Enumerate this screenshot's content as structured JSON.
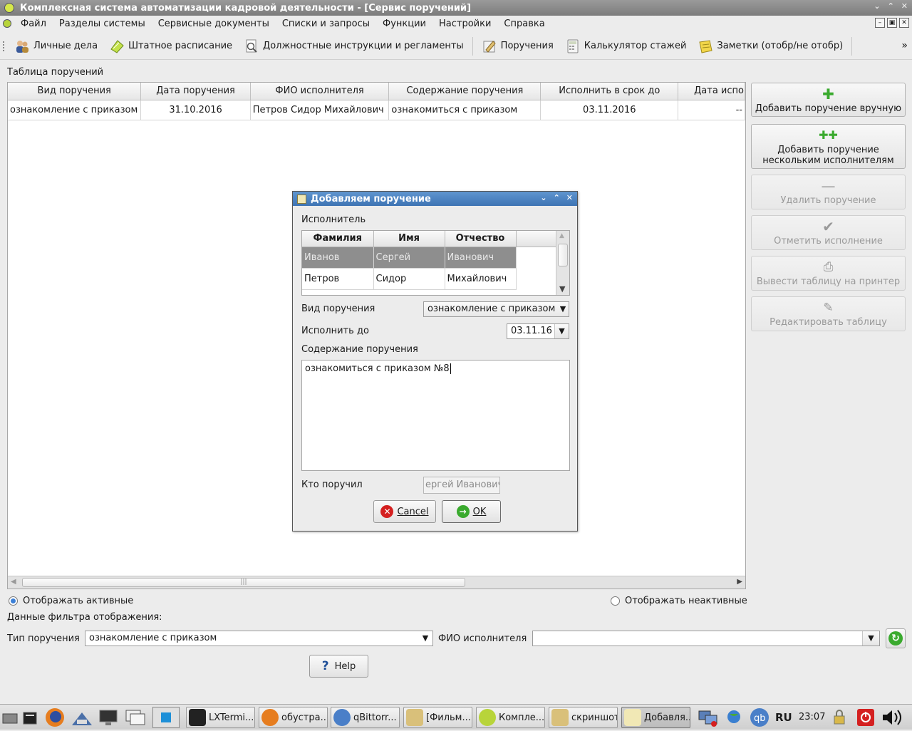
{
  "window": {
    "title": "Комплексная система автоматизации кадровой деятельности - [Сервис поручений]"
  },
  "menu": [
    "Файл",
    "Разделы системы",
    "Сервисные документы",
    "Списки и запросы",
    "Функции",
    "Настройки",
    "Справка"
  ],
  "toolbar": {
    "items": [
      "Личные дела",
      "Штатное расписание",
      "Должностные инструкции и регламенты",
      "Поручения",
      "Калькулятор стажей",
      "Заметки (отобр/не отобр)"
    ],
    "more": "»"
  },
  "main": {
    "section_title": "Таблица поручений",
    "columns": [
      "Вид поручения",
      "Дата поручения",
      "ФИО исполнителя",
      "Содержание поручения",
      "Исполнить в срок до",
      "Дата испо"
    ],
    "rows": [
      [
        "ознакомление с приказом",
        "31.10.2016",
        "Петров Сидор  Михайлович",
        "ознакомиться с приказом",
        "03.11.2016",
        "--"
      ]
    ]
  },
  "side_buttons": {
    "add_manual": "Добавить поручение вручную",
    "add_multi_1": "Добавить поручение",
    "add_multi_2": "нескольким исполнителям",
    "delete": "Удалить поручение",
    "mark_done": "Отметить исполнение",
    "print": "Вывести таблицу на принтер",
    "edit": "Редактировать таблицу"
  },
  "filter": {
    "show_active": "Отображать активные",
    "show_inactive": "Отображать неактивные",
    "filter_title": "Данные фильтра отображения:",
    "type_label": "Тип поручения",
    "type_value": "ознакомление с приказом",
    "fio_label": "ФИО исполнителя",
    "fio_value": "",
    "help": "Help"
  },
  "dialog": {
    "title": "Добавляем поручение",
    "executor_label": "Исполнитель",
    "executor_columns": [
      "Фамилия",
      "Имя",
      "Отчество"
    ],
    "executors": [
      [
        "Иванов",
        "Сергей",
        "Иванович"
      ],
      [
        "Петров",
        "Сидор",
        "Михайлович"
      ]
    ],
    "type_label": "Вид поручения",
    "type_value": "ознакомление с приказом",
    "due_label": "Исполнить до",
    "due_value": "03.11.16",
    "content_label": "Содержание поручения",
    "content_value": "ознакомиться с приказом №8",
    "assigner_label": "Кто поручил",
    "assigner_value": "ергей Иванович",
    "cancel": "Cancel",
    "ok": "OK"
  },
  "taskbar": {
    "tasks": [
      "LXTermi...",
      "обустра...",
      "qBittorr...",
      "[Фильм...",
      "Компле...",
      "скриншот",
      "Добавля..."
    ],
    "lang": "RU",
    "time": "23:07"
  },
  "colors": {
    "dialog_title": "#3e74b4",
    "selection": "#8e8e8e",
    "add_icon": "#3aaa2e",
    "cancel_icon": "#d42020",
    "shutdown": "#d42020"
  }
}
